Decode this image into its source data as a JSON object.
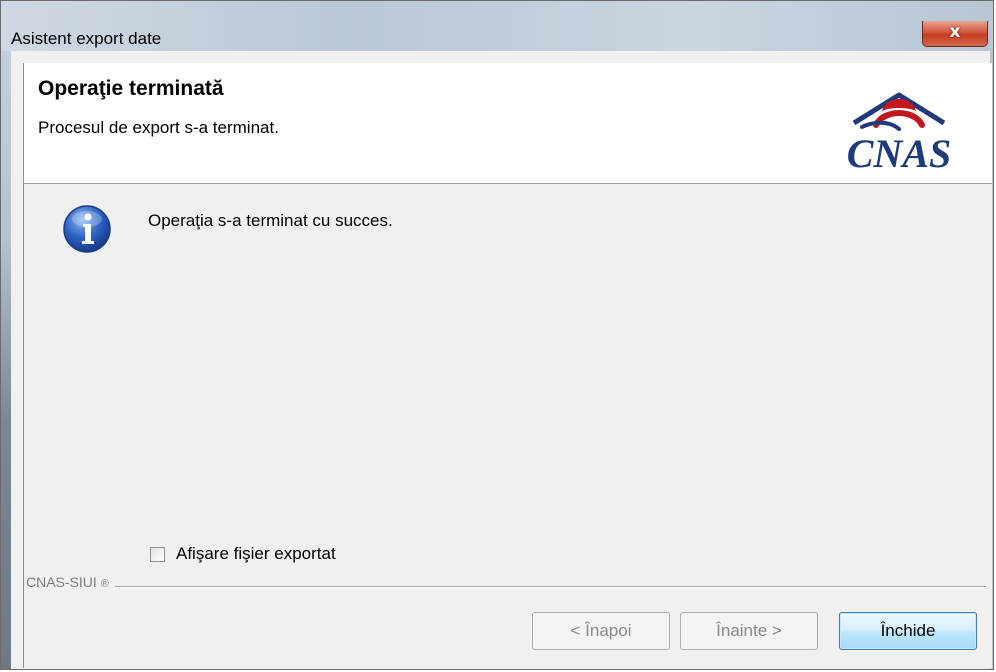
{
  "window": {
    "title": "Asistent export date",
    "close_glyph": "x"
  },
  "header": {
    "title": "Operaţie terminată",
    "subtitle": "Procesul de export s-a terminat.",
    "logo_text": "CNAS",
    "logo_colors": {
      "text": "#1f3a7a",
      "roof": "#c4161c",
      "hand": "#1f3a7a"
    }
  },
  "content": {
    "icon": "info-icon",
    "message": "Operaţia s-a terminat cu succes.",
    "checkbox_label": "Afişare fişier exportat",
    "checkbox_checked": false
  },
  "footer": {
    "brand": "CNAS-SIUI",
    "brand_icon": "circle-r-icon",
    "buttons": {
      "back": "< Înapoi",
      "next": "Înainte >",
      "close": "Închide"
    },
    "back_enabled": false,
    "next_enabled": false
  }
}
